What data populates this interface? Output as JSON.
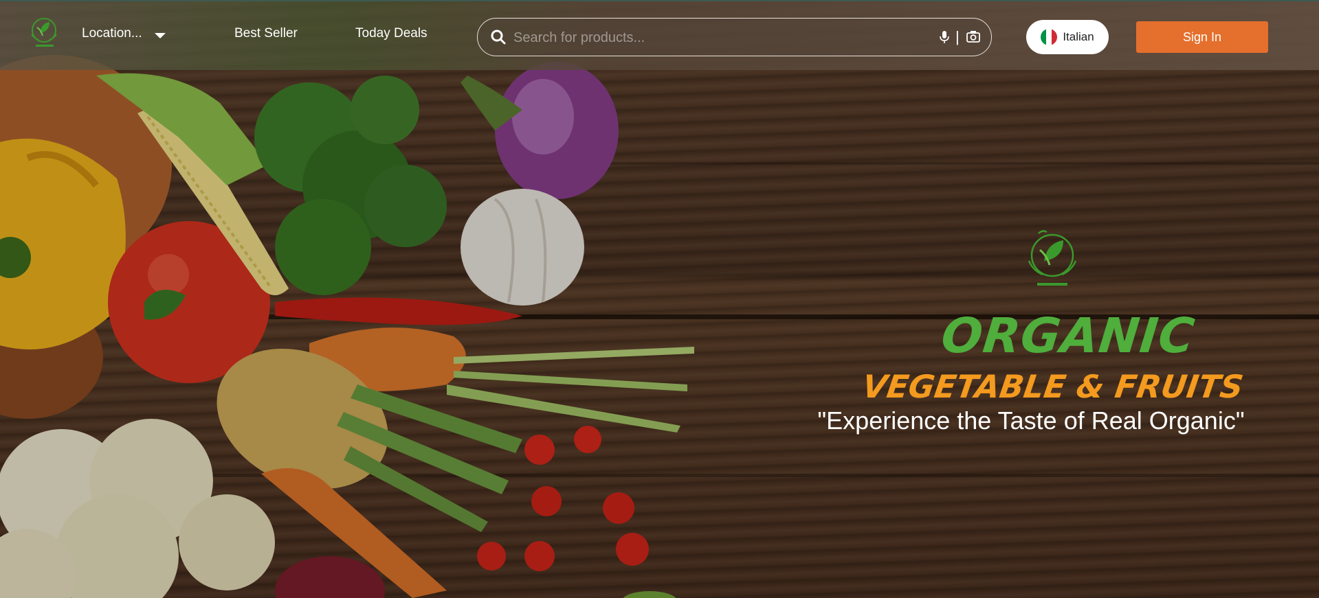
{
  "header": {
    "location_label": "Location...",
    "nav": [
      {
        "label": "Best Seller"
      },
      {
        "label": "Today Deals"
      }
    ],
    "search": {
      "placeholder": "Search for products...",
      "value": ""
    },
    "language": {
      "label": "Italian",
      "flag_colors": [
        "#009246",
        "#ffffff",
        "#ce2b37"
      ]
    },
    "sign_in_label": "Sign In"
  },
  "hero": {
    "headline": "ORGANIC",
    "subheadline": "VEGETABLE & FRUITS",
    "tagline": "\"Experience the Taste of Real Organic\""
  },
  "icons": [
    "leaf-logo-icon",
    "chevron-down-icon",
    "search-icon",
    "microphone-icon",
    "camera-icon",
    "italy-flag-icon"
  ],
  "colors": {
    "accent": "#e56f2c",
    "headline": "#4fae3c",
    "subheadline": "#f39a1f",
    "logo_green": "#3a9a2c"
  }
}
